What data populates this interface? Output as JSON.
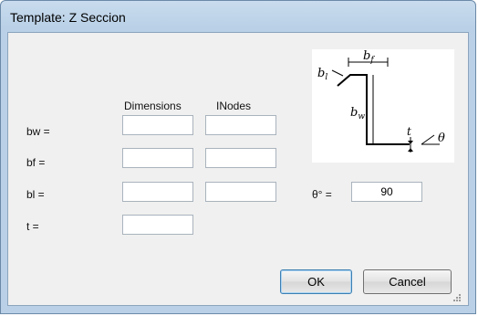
{
  "window": {
    "title": "Template: Z Seccion"
  },
  "columns": {
    "dimensions": "Dimensions",
    "inodes": "INodes"
  },
  "rows": [
    {
      "label": "bw =",
      "dimension": "",
      "inode": ""
    },
    {
      "label": "bf =",
      "dimension": "",
      "inode": ""
    },
    {
      "label": "bl =",
      "dimension": "",
      "inode": ""
    },
    {
      "label": "t =",
      "dimension": ""
    }
  ],
  "angle": {
    "label": "θ° =",
    "value": "90"
  },
  "diagram": {
    "labels": {
      "bl": "b",
      "bl_sub": "l",
      "bf": "b",
      "bf_sub": "f",
      "bw": "b",
      "bw_sub": "w",
      "t": "t",
      "theta": "θ"
    }
  },
  "buttons": {
    "ok": "OK",
    "cancel": "Cancel"
  }
}
